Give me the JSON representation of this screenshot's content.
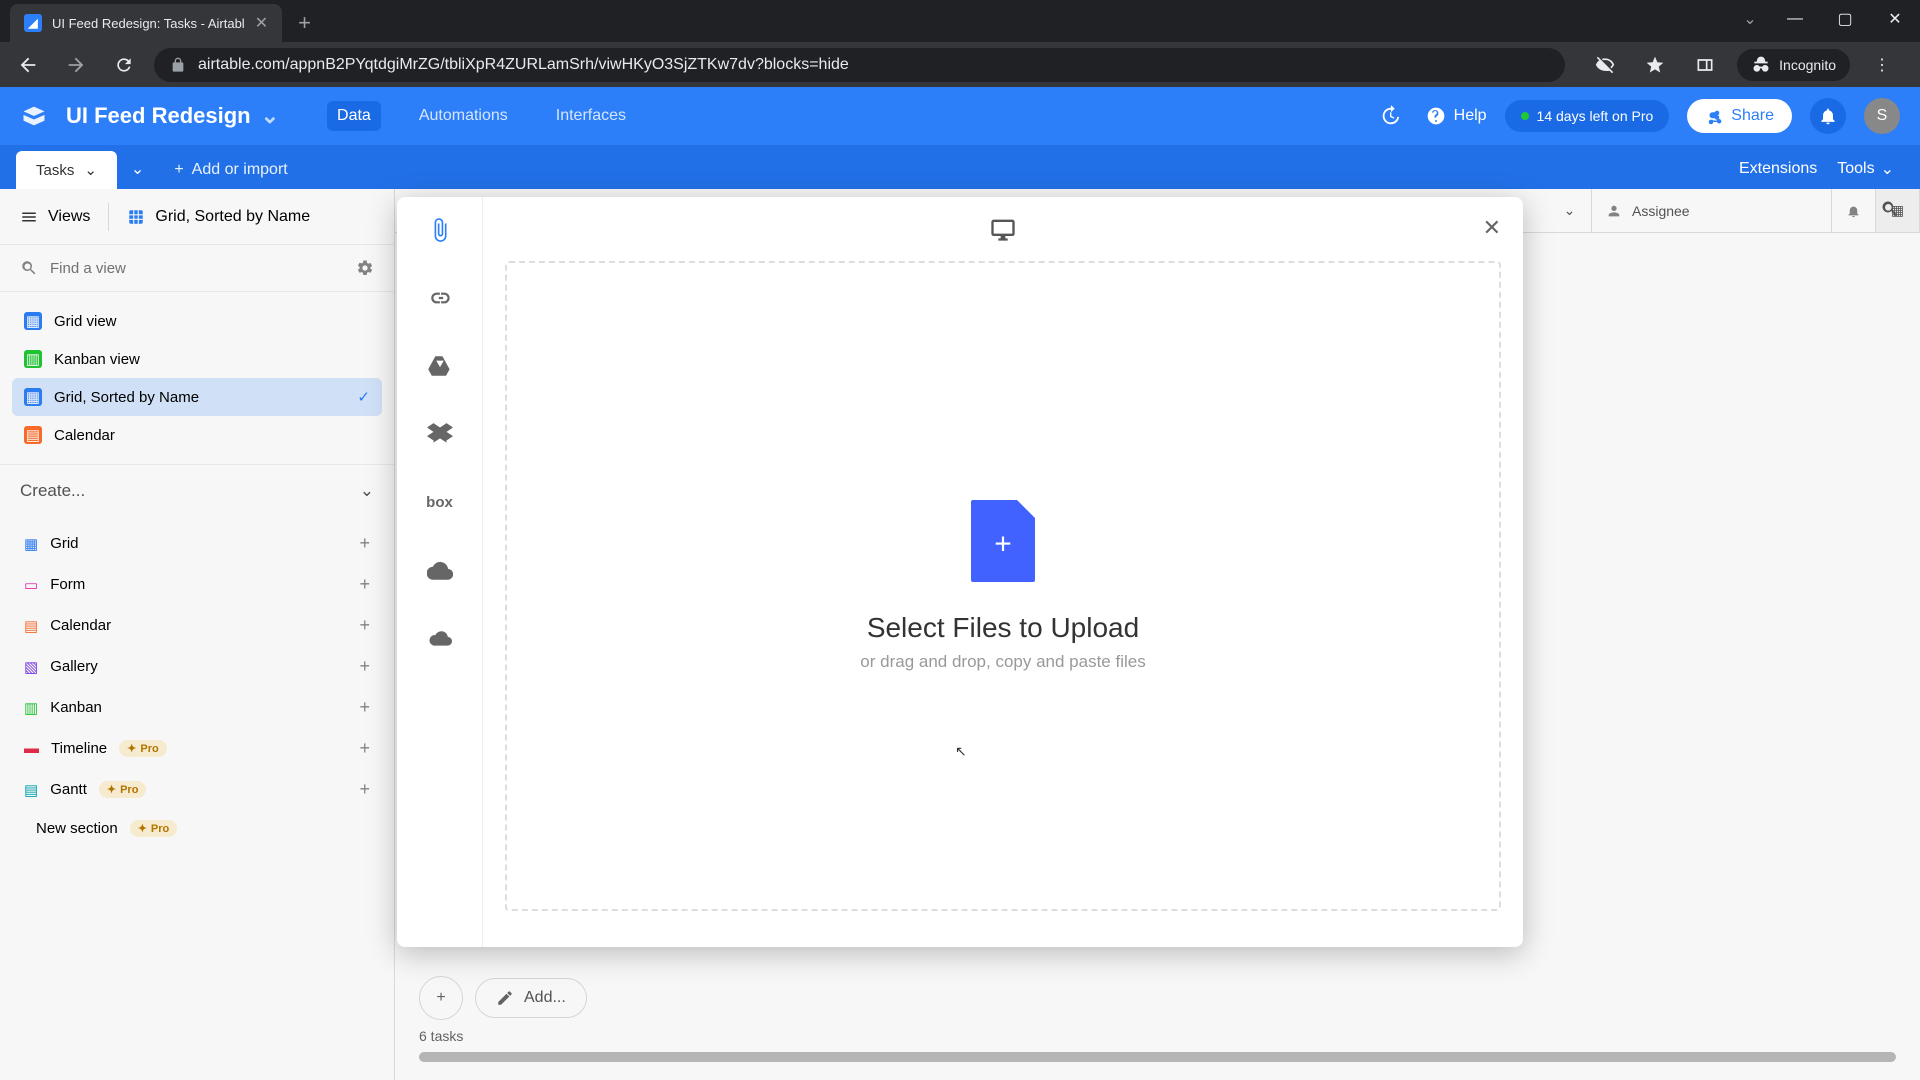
{
  "browser": {
    "tab_title": "UI Feed Redesign: Tasks - Airtabl",
    "url": "airtable.com/appnB2PYqtdgiMrZG/tbliXpR4ZURLamSrh/viwHKyO3SjZTKw7dv?blocks=hide",
    "incognito_label": "Incognito"
  },
  "topbar": {
    "base_name": "UI Feed Redesign",
    "tabs": {
      "data": "Data",
      "automations": "Automations",
      "interfaces": "Interfaces"
    },
    "help": "Help",
    "trial": "14 days left on Pro",
    "share": "Share",
    "avatar_initial": "S"
  },
  "tablebar": {
    "active_table": "Tasks",
    "add_or_import": "Add or import",
    "extensions": "Extensions",
    "tools": "Tools"
  },
  "views_toolbar": {
    "views_label": "Views",
    "current_view": "Grid, Sorted by Name"
  },
  "search_views": {
    "placeholder": "Find a view"
  },
  "view_list": [
    {
      "label": "Grid view",
      "color": "blue"
    },
    {
      "label": "Kanban view",
      "color": "green"
    },
    {
      "label": "Grid, Sorted by Name",
      "color": "blue",
      "active": true
    },
    {
      "label": "Calendar",
      "color": "orange"
    }
  ],
  "create": {
    "header": "Create...",
    "items": [
      {
        "label": "Grid",
        "icon": "grid",
        "color": "ci-blue"
      },
      {
        "label": "Form",
        "icon": "form",
        "color": "ci-pink"
      },
      {
        "label": "Calendar",
        "icon": "calendar",
        "color": "ci-orange"
      },
      {
        "label": "Gallery",
        "icon": "gallery",
        "color": "ci-purple"
      },
      {
        "label": "Kanban",
        "icon": "kanban",
        "color": "ci-green"
      },
      {
        "label": "Timeline",
        "icon": "timeline",
        "color": "ci-red",
        "pro": true
      },
      {
        "label": "Gantt",
        "icon": "gantt",
        "color": "ci-teal",
        "pro": true
      }
    ],
    "new_section": "New section",
    "pro_label": "Pro"
  },
  "grid": {
    "assignee_col": "Assignee",
    "add_placeholder": "Add...",
    "task_count": "6 tasks"
  },
  "modal": {
    "title": "Select Files to Upload",
    "subtitle": "or drag and drop, copy and paste files",
    "box_label": "box"
  }
}
